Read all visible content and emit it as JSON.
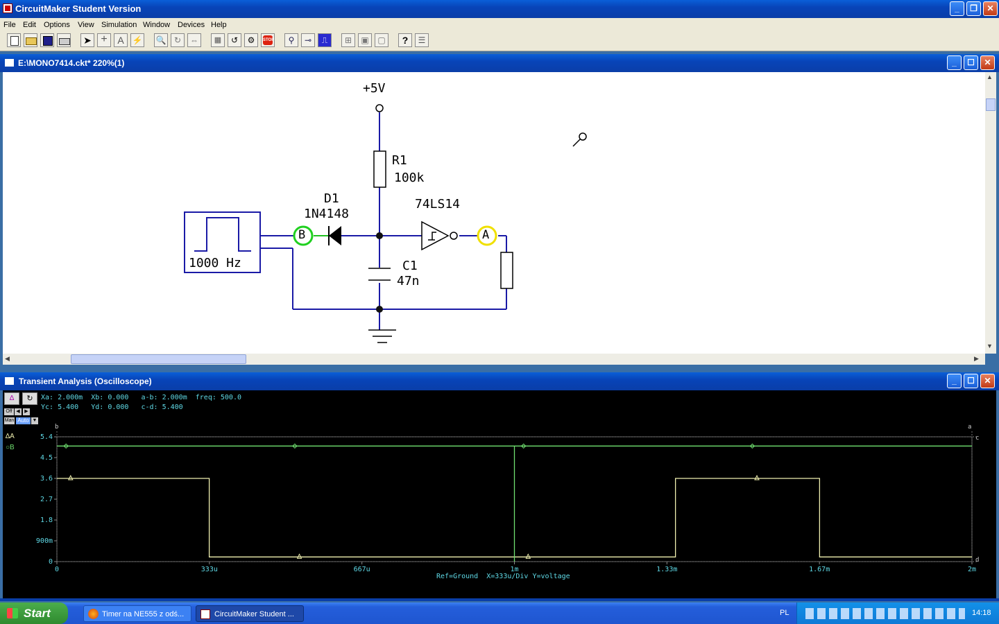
{
  "app": {
    "title": "CircuitMaker Student Version"
  },
  "menu": [
    "File",
    "Edit",
    "Options",
    "View",
    "Simulation",
    "Window",
    "Devices",
    "Help"
  ],
  "toolbar": [
    "new",
    "open",
    "save",
    "print",
    "arrow",
    "wire",
    "text",
    "probe",
    "zoom",
    "rotate",
    "mirror",
    "macro",
    "reset",
    "step",
    "stop",
    "probe-tool",
    "trace",
    "waveform",
    "align",
    "group",
    "delete",
    "help",
    "options"
  ],
  "circuit_window": {
    "title": "E:\\MONO7414.ckt* 220%(1)",
    "labels": {
      "vcc": "+5V",
      "r1_name": "R1",
      "r1_value": "100k",
      "d1_name": "D1",
      "d1_value": "1N4148",
      "ic": "74LS14",
      "c1_name": "C1",
      "c1_value": "47n",
      "gen_freq": "1000 Hz",
      "probe_b": "B",
      "probe_a": "A"
    },
    "colors": {
      "wire": "#1a1aa6",
      "probe_b": "#20d020",
      "probe_a": "#f0e000"
    }
  },
  "scope_window": {
    "title": "Transient Analysis (Oscilloscope)",
    "readout_line1": "Xa: 2.000m  Xb: 0.000   a-b: 2.000m  freq: 500.0",
    "readout_line2": "Yc: 5.400   Yd: 0.000   c-d: 5.400",
    "controls": {
      "off": "Off",
      "man": "Man",
      "auto": "Auto"
    },
    "legend": {
      "a": "A",
      "b": "B"
    },
    "footer": "Ref=Ground  X=333u/Div Y=voltage",
    "cursor_labels": {
      "a": "a",
      "b": "b",
      "c": "c",
      "d": "d"
    }
  },
  "chart_data": {
    "type": "line",
    "x_tick_labels": [
      "0",
      "333u",
      "667u",
      "1m",
      "1.33m",
      "1.67m",
      "2m"
    ],
    "y_tick_labels": [
      "5.4",
      "4.5",
      "3.6",
      "2.7",
      "1.8",
      "900m",
      "0"
    ],
    "xlim": [
      0,
      0.002
    ],
    "ylim": [
      0,
      5.4
    ],
    "series": [
      {
        "name": "A",
        "color": "#f0f0b0",
        "x": [
          0,
          0.000333,
          0.000333,
          0.001352,
          0.001352,
          0.001352,
          0.001352,
          0.001667,
          0.001667,
          0.002
        ],
        "y": [
          3.6,
          3.6,
          0.2,
          0.2,
          3.6,
          3.6,
          3.6,
          3.6,
          0.2,
          0.2
        ]
      },
      {
        "name": "B",
        "color": "#70e070",
        "x": [
          0,
          0.001,
          0.001,
          0.001,
          0.001,
          0.002
        ],
        "y": [
          5.0,
          5.0,
          0.0,
          0.0,
          5.0,
          5.0
        ]
      }
    ]
  },
  "taskbar": {
    "start": "Start",
    "task1": "Timer na NE555 z odś...",
    "task2": "CircuitMaker Student ...",
    "lang": "PL",
    "clock": "14:18"
  }
}
